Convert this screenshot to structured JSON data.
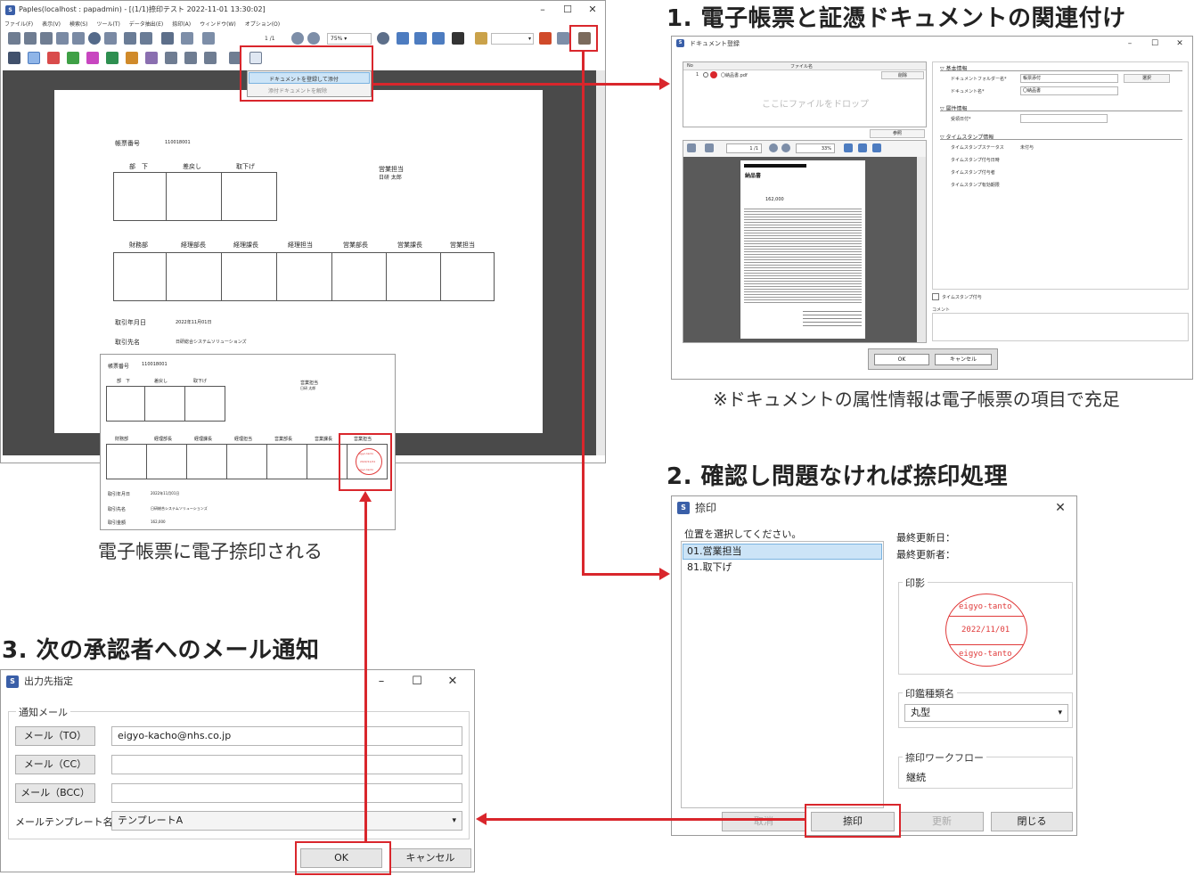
{
  "headings": {
    "step1": "1. 電子帳票と証憑ドキュメントの関連付け",
    "step2": "2. 確認し問題なければ捺印処理",
    "step3": "3. 次の承認者へのメール通知",
    "note1": "※ドキュメントの属性情報は電子帳票の項目で充足",
    "stamp_caption": "電子帳票に電子捺印される"
  },
  "main_window": {
    "title": "Paples(localhost : papadmin) - [(1/1)捺印テスト 2022-11-01 13:30:02]",
    "menu": [
      "ファイル(F)",
      "表示(V)",
      "検索(S)",
      "ツール(T)",
      "データ抽出(E)",
      "捺印(A)",
      "ウィンドウ(W)",
      "オプション(O)"
    ],
    "page_indicator": "1 /1",
    "zoom": "75%",
    "context_menu": [
      "ドキュメントを登録して添付",
      "添付ドキュメントを解除"
    ],
    "form": {
      "slip_no_label": "帳票番号",
      "slip_no": "110018001",
      "approval_row1": [
        "部　下",
        "差戻し",
        "取下げ"
      ],
      "sales_rep_label": "営業担当",
      "sales_rep_name": "日研 太郎",
      "approval_row2": [
        "財務部",
        "経理部長",
        "経理課長",
        "経理担当",
        "営業部長",
        "営業課長",
        "営業担当"
      ],
      "date_label": "取引年月日",
      "date_value": "2022年11月01日",
      "partner_label": "取引先名",
      "partner_value": "日研総合システムソリューションズ",
      "amount_label": "取引金額",
      "amount_value": "162,000",
      "stamp_text_top": "eigyo-tanto",
      "stamp_text_mid": "2022/11/01",
      "stamp_text_bot": "eigyo-tanto"
    }
  },
  "doc_register": {
    "title": "ドキュメント登録",
    "list_headers": [
      "No",
      "ファイル名",
      "削除"
    ],
    "file_row": {
      "no": "1",
      "name": "〇納品書.pdf",
      "action": "削除"
    },
    "drop_hint": "ここにファイルをドロップ",
    "browse": "参照",
    "page_indicator": "1 /1",
    "zoom": "33%",
    "preview_doc_title": "納品書",
    "preview_amount": "162,000",
    "basic_section": "▽ 基本情報",
    "folder_label": "ドキュメントフォルダー名*",
    "folder_value": "帳票添付",
    "folder_button": "選択",
    "docname_label": "ドキュメント名*",
    "docname_value": "〇納品書",
    "attr_section": "▽ 属性情報",
    "recv_label": "受領日付*",
    "ts_section": "▽ タイムスタンプ情報",
    "ts_rows": [
      {
        "label": "タイムスタンプステータス",
        "value": "未付与"
      },
      {
        "label": "タイムスタンプ付与日時",
        "value": ""
      },
      {
        "label": "タイムスタンプ付与者",
        "value": ""
      },
      {
        "label": "タイムスタンプ有効期限",
        "value": ""
      }
    ],
    "ts_checkbox": "タイムスタンプ付与",
    "comment_label": "コメント",
    "ok": "OK",
    "cancel": "キャンセル"
  },
  "stamp_dialog": {
    "title": "捺印",
    "select_prompt": "位置を選択してください。",
    "positions": [
      "01.営業担当",
      "81.取下げ"
    ],
    "selected_index": 0,
    "last_updated_date_label": "最終更新日：",
    "last_updated_by_label": "最終更新者：",
    "impression_label": "印影",
    "stamp_top": "eigyo-tanto",
    "stamp_mid": "2022/11/01",
    "stamp_bot": "eigyo-tanto",
    "stamp_type_label": "印鑑種類名",
    "stamp_type_value": "丸型",
    "workflow_label": "捺印ワークフロー",
    "workflow_value": "継続",
    "buttons": {
      "clear": "取消",
      "stamp": "捺印",
      "update": "更新",
      "close": "閉じる"
    }
  },
  "output_dialog": {
    "title": "出力先指定",
    "group_label": "通知メール",
    "to_label": "メール（TO）",
    "to_value": "eigyo-kacho@nhs.co.jp",
    "cc_label": "メール（CC）",
    "cc_value": "",
    "bcc_label": "メール（BCC）",
    "bcc_value": "",
    "template_label": "メールテンプレート名",
    "template_value": "テンプレートA",
    "ok": "OK",
    "cancel": "キャンセル"
  },
  "colors": {
    "accent_red": "#d9262c",
    "selection": "#cce4f7",
    "stamp_red": "#e03a3a"
  }
}
